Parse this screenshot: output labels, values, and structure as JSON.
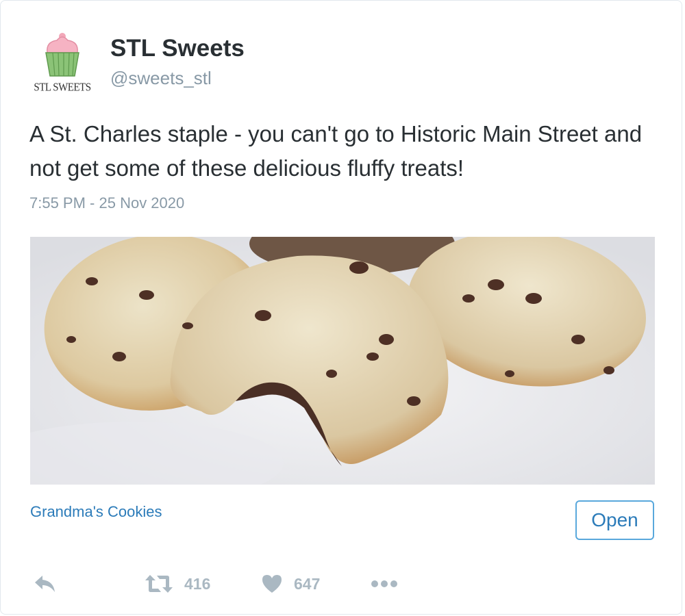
{
  "account": {
    "display_name": "STL Sweets",
    "handle": "@sweets_stl",
    "avatar_logo_text": "STL SWEETS"
  },
  "tweet": {
    "text": "A St. Charles staple - you can't go to Historic Main Street and not get some of these delicious fluffy treats!",
    "timestamp": "7:55 PM - 25 Nov 2020"
  },
  "media": {
    "subject": "chocolate-chip-cookies-photo"
  },
  "link_card": {
    "title": "Grandma's Cookies",
    "open_label": "Open"
  },
  "actions": {
    "reply_icon": "reply-icon",
    "retweet_icon": "retweet-icon",
    "retweet_count": "416",
    "like_icon": "heart-icon",
    "like_count": "647",
    "more_icon": "more-dots-icon"
  },
  "colors": {
    "link_blue": "#2b7bb9",
    "button_border": "#59a8dc",
    "muted_gray": "#8899a6",
    "icon_gray": "#aab8c2",
    "text_dark": "#292f33"
  }
}
